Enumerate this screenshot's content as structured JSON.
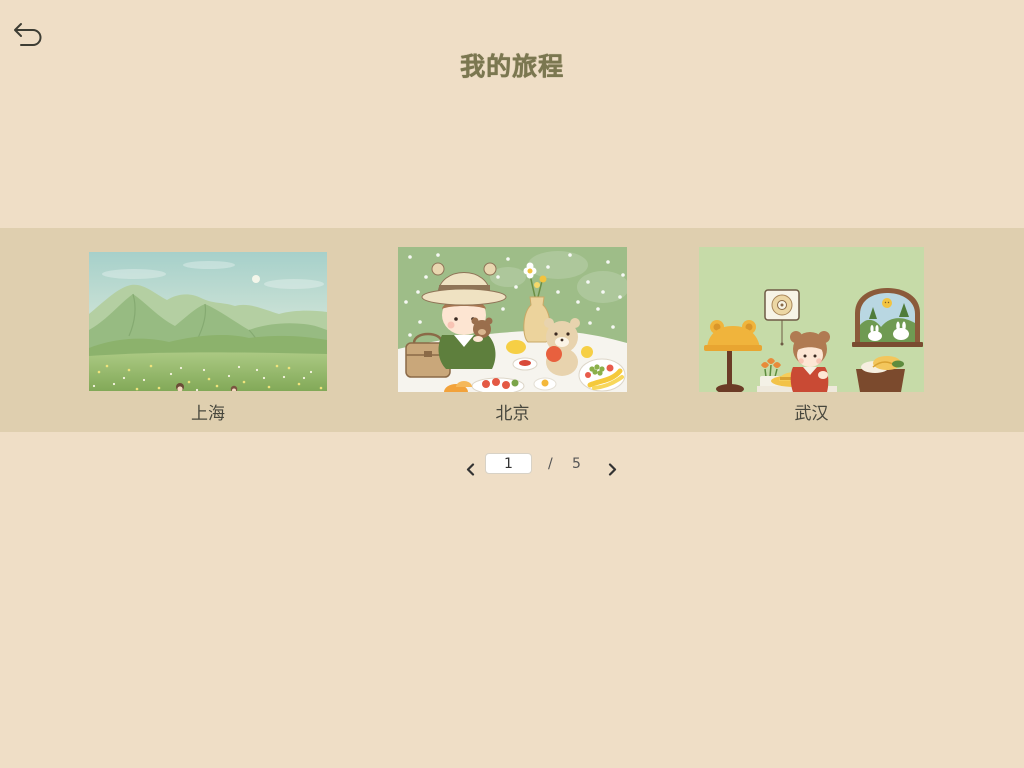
{
  "page": {
    "title": "我的旅程"
  },
  "icons": {
    "back": "back-icon",
    "prev_page": "chevron-left-icon",
    "next_page": "chevron-right-icon"
  },
  "colors": {
    "background": "#efdec6",
    "band": "#dfcfaf",
    "title": "#7b7750",
    "label": "#47473d"
  },
  "trips": [
    {
      "label": "上海"
    },
    {
      "label": "北京"
    },
    {
      "label": "武汉"
    }
  ],
  "pagination": {
    "current": "1",
    "separator": "/",
    "total": "5"
  }
}
